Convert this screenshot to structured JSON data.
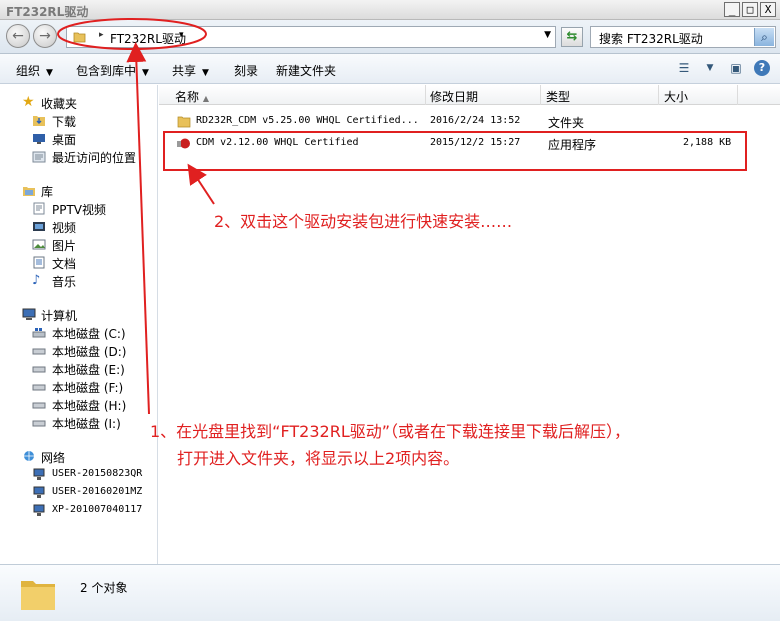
{
  "window": {
    "title": "FT232RL驱动",
    "minimize": "_",
    "maximize": "□",
    "close": "X"
  },
  "address": {
    "path": "FT232RL驱动",
    "search_placeholder": "搜索 FT232RL驱动"
  },
  "toolbar": {
    "organize": "组织",
    "include_library": "包含到库中",
    "share": "共享",
    "burn": "刻录",
    "new_folder": "新建文件夹"
  },
  "sidebar": {
    "favorites": "收藏夹",
    "downloads": "下载",
    "desktop": "桌面",
    "recent": "最近访问的位置",
    "libraries": "库",
    "pptv": "PPTV视频",
    "videos": "视频",
    "pictures": "图片",
    "documents": "文档",
    "music": "音乐",
    "computer": "计算机",
    "drives": [
      "本地磁盘 (C:)",
      "本地磁盘 (D:)",
      "本地磁盘 (E:)",
      "本地磁盘 (F:)",
      "本地磁盘 (H:)",
      "本地磁盘 (I:)"
    ],
    "network": "网络",
    "network_items": [
      "USER-20150823QR",
      "USER-20160201MZ",
      "XP-201007040117"
    ]
  },
  "columns": {
    "name": "名称",
    "date": "修改日期",
    "type": "类型",
    "size": "大小"
  },
  "files": [
    {
      "name": "RD232R_CDM v5.25.00 WHQL Certified...",
      "date": "2016/2/24 13:52",
      "type": "文件夹",
      "size": ""
    },
    {
      "name": "CDM v2.12.00 WHQL Certified",
      "date": "2015/12/2 15:27",
      "type": "应用程序",
      "size": "2,188 KB"
    }
  ],
  "status": {
    "count": "2 个对象"
  },
  "annotations": {
    "note2": "2、双击这个驱动安装包进行快速安装……",
    "note1_line1": "1、在光盘里找到“FT232RL驱动”（或者在下载连接里下载后解压），",
    "note1_line2": "打开进入文件夹，将显示以上2项内容。"
  },
  "colors": {
    "annotation": "#e02020",
    "folder": "#e8c15a"
  }
}
